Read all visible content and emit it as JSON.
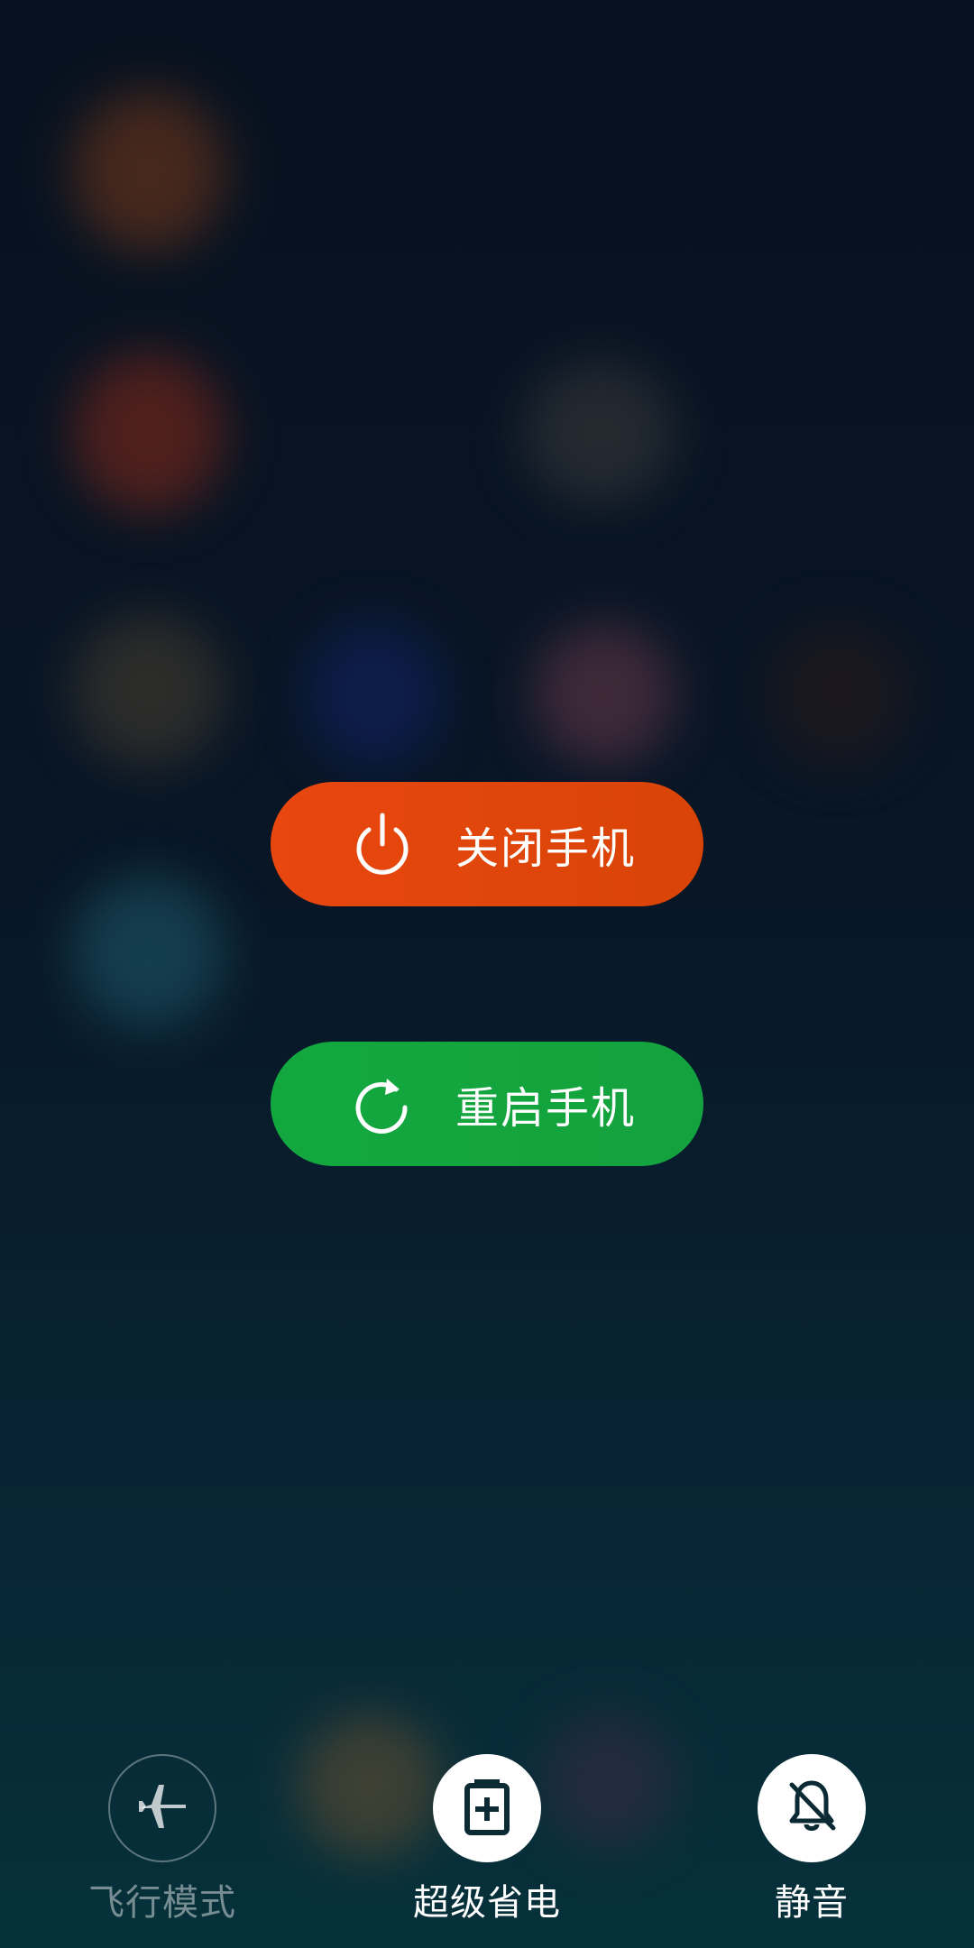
{
  "power_menu": {
    "power_off_label": "关闭手机",
    "restart_label": "重启手机"
  },
  "quick_actions": {
    "airplane_label": "飞行模式",
    "super_power_saving_label": "超级省电",
    "mute_label": "静音"
  },
  "colors": {
    "power_off": "#e0470c",
    "restart": "#14a63f",
    "background": "#081626"
  },
  "icons": {
    "power_off": "power-icon",
    "restart": "restart-icon",
    "airplane": "airplane-icon",
    "battery": "battery-plus-icon",
    "mute": "bell-off-icon"
  }
}
